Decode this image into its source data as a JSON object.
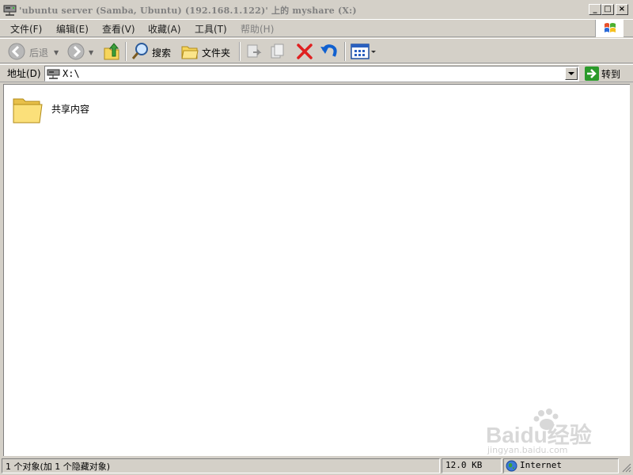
{
  "window": {
    "title": "'ubuntu server (Samba, Ubuntu) (192.168.1.122)' 上的 myshare (X:)"
  },
  "menu": {
    "items": [
      "文件(F)",
      "编辑(E)",
      "查看(V)",
      "收藏(A)",
      "工具(T)",
      "帮助(H)"
    ]
  },
  "toolbar": {
    "back_label": "后退",
    "search_label": "搜索",
    "folders_label": "文件夹"
  },
  "address": {
    "label": "地址(D)",
    "value": "X:\\",
    "go_label": "转到"
  },
  "content": {
    "items": [
      {
        "name": "共享内容",
        "type": "folder"
      }
    ]
  },
  "watermark": {
    "text": "Baidu经验",
    "url": "jingyan.baidu.com"
  },
  "status": {
    "objects": "1 个对象(加 1 个隐藏对象)",
    "size": "12.0 KB",
    "zone": "Internet"
  },
  "colors": {
    "title_text": "#808080",
    "chrome": "#d4d0c8",
    "delete_red": "#e02020",
    "undo_blue": "#1060d0",
    "go_green": "#2a9a2a"
  }
}
